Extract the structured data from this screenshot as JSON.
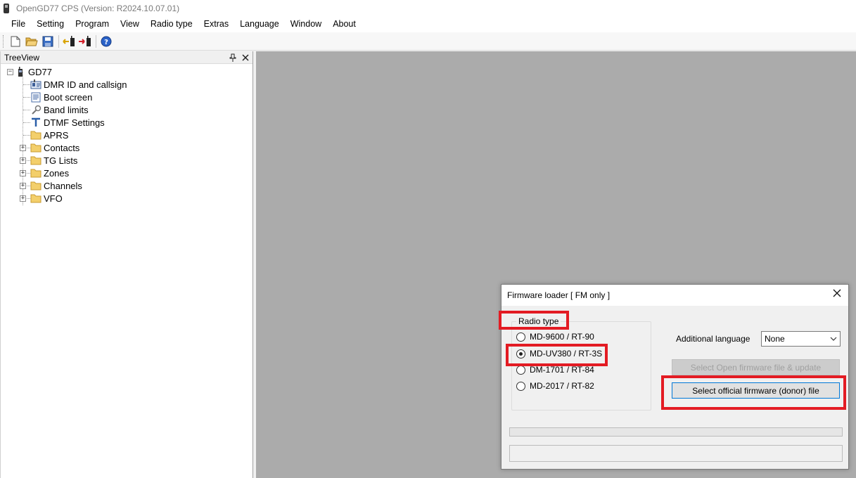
{
  "window": {
    "title": "OpenGD77 CPS (Version: R2024.10.07.01)"
  },
  "menu": [
    "File",
    "Setting",
    "Program",
    "View",
    "Radio type",
    "Extras",
    "Language",
    "Window",
    "About"
  ],
  "toolbar": {
    "icons": [
      "new-file-icon",
      "open-folder-icon",
      "save-icon",
      "read-from-radio-icon",
      "write-to-radio-icon",
      "help-icon"
    ]
  },
  "treeview": {
    "title": "TreeView",
    "root": "GD77",
    "items": [
      {
        "label": "DMR ID and callsign",
        "icon": "dmr-id-icon",
        "expandable": false
      },
      {
        "label": "Boot screen",
        "icon": "boot-screen-icon",
        "expandable": false
      },
      {
        "label": "Band limits",
        "icon": "wrench-icon",
        "expandable": false
      },
      {
        "label": "DTMF Settings",
        "icon": "dtmf-icon",
        "expandable": false
      },
      {
        "label": "APRS",
        "icon": "folder-icon",
        "expandable": false
      },
      {
        "label": "Contacts",
        "icon": "folder-icon",
        "expandable": true
      },
      {
        "label": "TG Lists",
        "icon": "folder-icon",
        "expandable": true
      },
      {
        "label": "Zones",
        "icon": "folder-icon",
        "expandable": true
      },
      {
        "label": "Channels",
        "icon": "folder-icon",
        "expandable": true
      },
      {
        "label": "VFO",
        "icon": "folder-icon",
        "expandable": true
      }
    ]
  },
  "dialog": {
    "title": "Firmware loader [ FM only ]",
    "radio_group": {
      "legend": "Radio type",
      "options": [
        "MD-9600 / RT-90",
        "MD-UV380 / RT-3S",
        "DM-1701 / RT-84",
        "MD-2017 / RT-82"
      ],
      "selected": "MD-UV380 / RT-3S"
    },
    "language": {
      "label": "Additional language",
      "value": "None"
    },
    "buttons": {
      "open_firmware": "Select Open firmware file & update",
      "official_firmware": "Select official firmware (donor) file"
    }
  },
  "colors": {
    "highlight": "#e31b23",
    "mdi_background": "#ababab"
  }
}
